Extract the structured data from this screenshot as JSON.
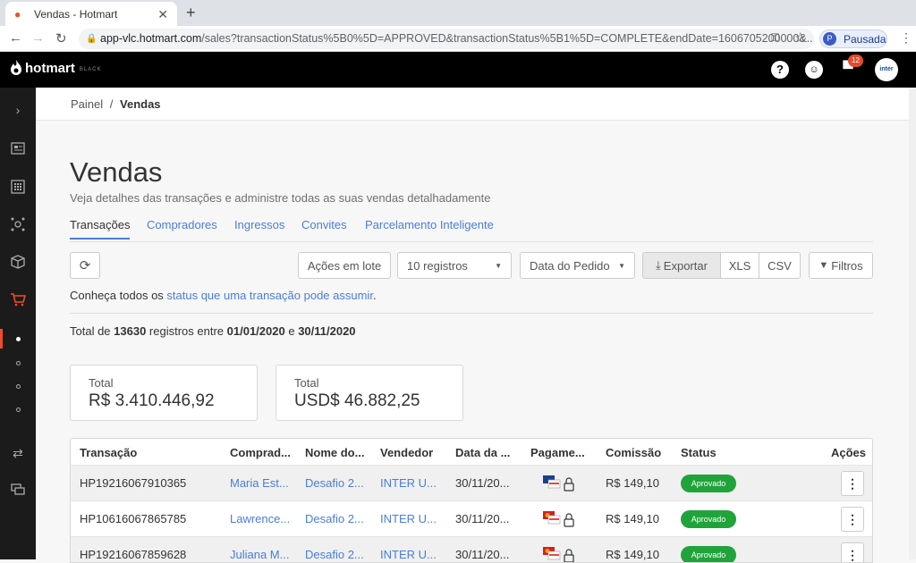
{
  "browser": {
    "tab_title": "Vendas - Hotmart",
    "url_host": "app-vlc.hotmart.com",
    "url_rest": "/sales?transactionStatus%5B0%5D=APPROVED&transactionStatus%5B1%5D=COMPLETE&endDate=1606705200000&...",
    "profile_initial": "P",
    "profile_label": "Pausada"
  },
  "topbar": {
    "logo_text": "hotmart",
    "logo_suffix": "BLACK",
    "notification_count": "12",
    "avatar_text": "inter"
  },
  "breadcrumb": {
    "root": "Painel",
    "separator": "/",
    "current": "Vendas"
  },
  "page": {
    "title": "Vendas",
    "subtitle": "Veja detalhes das transações e administre todas as suas vendas detalhadamente"
  },
  "tabs": [
    {
      "label": "Transações",
      "active": true
    },
    {
      "label": "Compradores"
    },
    {
      "label": "Ingressos"
    },
    {
      "label": "Convites"
    },
    {
      "label": "Parcelamento Inteligente"
    }
  ],
  "toolbar": {
    "bulk_actions": "Ações em lote",
    "page_size": "10 registros",
    "date_filter": "Data do Pedido",
    "export": "Exportar",
    "xls": "XLS",
    "csv": "CSV",
    "filters": "Filtros"
  },
  "note": {
    "prefix": "Conheça todos os ",
    "link": "status que uma transação pode assumir",
    "suffix": "."
  },
  "totals_line": {
    "p1": "Total de ",
    "count": "13630",
    "p2": " registros entre ",
    "start": "01/01/2020",
    "p3": " e ",
    "end": "30/11/2020"
  },
  "cards": [
    {
      "label": "Total",
      "value": "R$ 3.410.446,92"
    },
    {
      "label": "Total",
      "value": "USD$ 46.882,25"
    }
  ],
  "table": {
    "headers": [
      "Transação",
      "Comprad...",
      "Nome do...",
      "Vendedor",
      "Data da ...",
      "Pagame...",
      "Comissão",
      "Status",
      "Ações"
    ],
    "rows": [
      {
        "id": "HP19216067910365",
        "buyer": "Maria Est...",
        "product": "Desafio 2...",
        "seller": "INTER U...",
        "date": "30/11/20...",
        "commission": "R$ 149,10",
        "status": "Aprovado"
      },
      {
        "id": "HP10616067865785",
        "buyer": "Lawrence...",
        "product": "Desafio 2...",
        "seller": "INTER U...",
        "date": "30/11/20...",
        "commission": "R$ 149,10",
        "status": "Aprovado"
      },
      {
        "id": "HP19216067859628",
        "buyer": "Juliana M...",
        "product": "Desafio 2...",
        "seller": "INTER U...",
        "date": "30/11/20...",
        "commission": "R$ 149,10",
        "status": "Aprovado"
      }
    ]
  },
  "colors": {
    "accent": "#4a7ddb",
    "brand": "#ef4e23",
    "success": "#21a33b"
  }
}
